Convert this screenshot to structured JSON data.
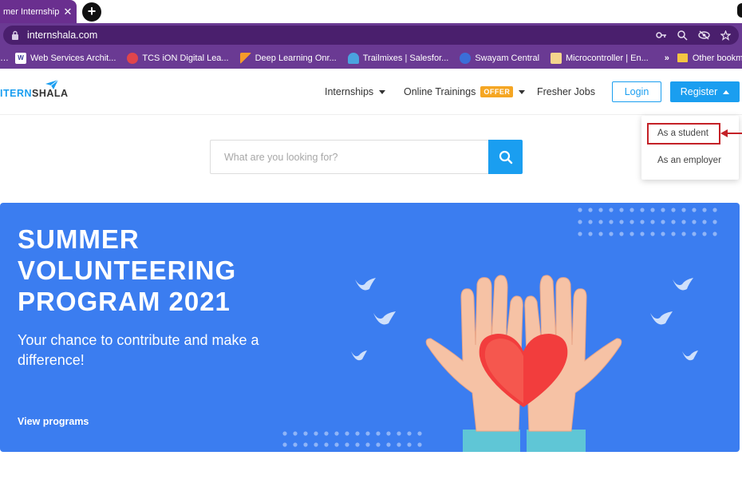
{
  "browser": {
    "tab_title": "mer Internship",
    "tab_close": "✕",
    "new_tab": "+",
    "url": "internshala.com",
    "bookmarks": [
      {
        "label": "Web Services Archit...",
        "icon": "ws-icon",
        "color": "#ffffff"
      },
      {
        "label": "TCS iON Digital Lea...",
        "icon": "tcs-icon",
        "color": "#e0454b"
      },
      {
        "label": "Deep Learning Onr...",
        "icon": "deeplearning-icon",
        "color": "#f59b2a"
      },
      {
        "label": "Trailmixes | Salesfor...",
        "icon": "trailhead-icon",
        "color": "#4aa3df"
      },
      {
        "label": "Swayam Central",
        "icon": "swayam-icon",
        "color": "#3b6ed8"
      },
      {
        "label": "Microcontroller | En...",
        "icon": "microcontroller-icon",
        "color": "#f4d58d"
      }
    ],
    "bookmarks_more": "»",
    "other_bookmarks": "Other bookma"
  },
  "header": {
    "logo_part1": "ITERN",
    "logo_part2": "SHALA",
    "nav": {
      "internships": "Internships",
      "online_trainings": "Online Trainings",
      "offer_badge": "OFFER",
      "fresher_jobs": "Fresher Jobs"
    },
    "login": "Login",
    "register": "Register"
  },
  "register_menu": {
    "student": "As a student",
    "employer": "As an employer"
  },
  "search": {
    "placeholder": "What are you looking for?"
  },
  "banner": {
    "title_line1": "SUMMER",
    "title_line2": "VOLUNTEERING",
    "title_line3": "PROGRAM 2021",
    "subtitle": "Your chance to contribute and make a difference!",
    "link": "View programs"
  },
  "colors": {
    "brand_blue": "#1a9ef0",
    "banner_blue": "#3b7df0",
    "chrome_purple": "#6a3a93",
    "offer_orange": "#f5a623",
    "annotation_red": "#c42127"
  }
}
